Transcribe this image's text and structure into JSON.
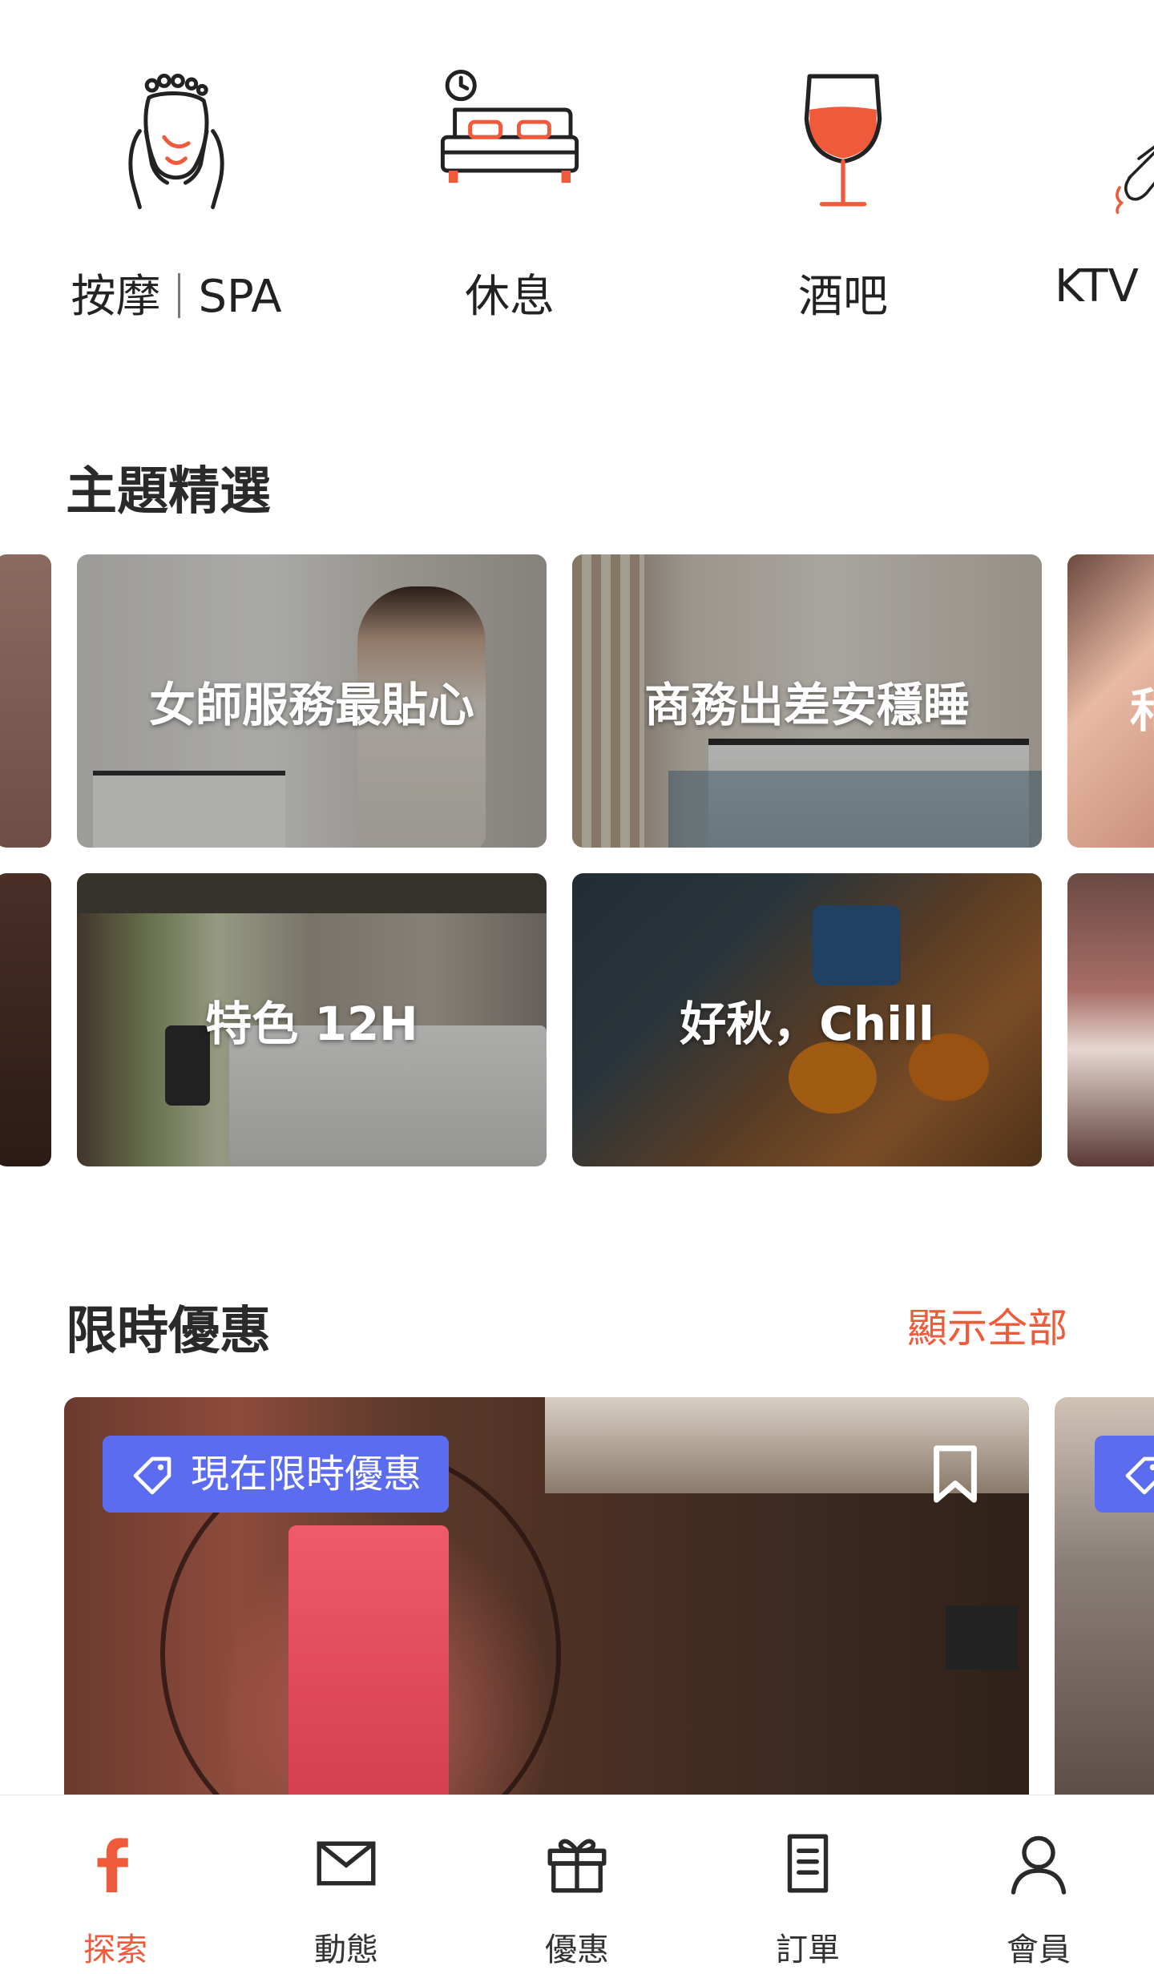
{
  "categories": [
    {
      "label": "按摩",
      "label2": "SPA",
      "icon": "foot-massage-icon"
    },
    {
      "label": "休息",
      "icon": "bed-clock-icon"
    },
    {
      "label": "酒吧",
      "icon": "wine-glass-icon"
    },
    {
      "label": "KTV",
      "icon": "microphone-icon"
    }
  ],
  "themes": {
    "title": "主題精選",
    "cards": [
      {
        "caption": "女師服務最貼心"
      },
      {
        "caption": "商務出差安穩睡"
      },
      {
        "caption": "特色 12H"
      },
      {
        "caption": "好秋，Chill"
      }
    ],
    "peek_caption": "和"
  },
  "deals": {
    "title": "限時優惠",
    "show_all": "顯示全部",
    "badge": "現在限時優惠",
    "badge_icon": "tag-icon",
    "bookmark_icon": "bookmark-icon"
  },
  "nav": [
    {
      "label": "探索",
      "icon": "brand-f-icon",
      "active": true
    },
    {
      "label": "動態",
      "icon": "mail-icon"
    },
    {
      "label": "優惠",
      "icon": "gift-icon"
    },
    {
      "label": "訂單",
      "icon": "document-icon"
    },
    {
      "label": "會員",
      "icon": "person-icon"
    }
  ],
  "colors": {
    "accent": "#ee5a3a",
    "badge": "#5b6cf0",
    "text": "#222222"
  }
}
